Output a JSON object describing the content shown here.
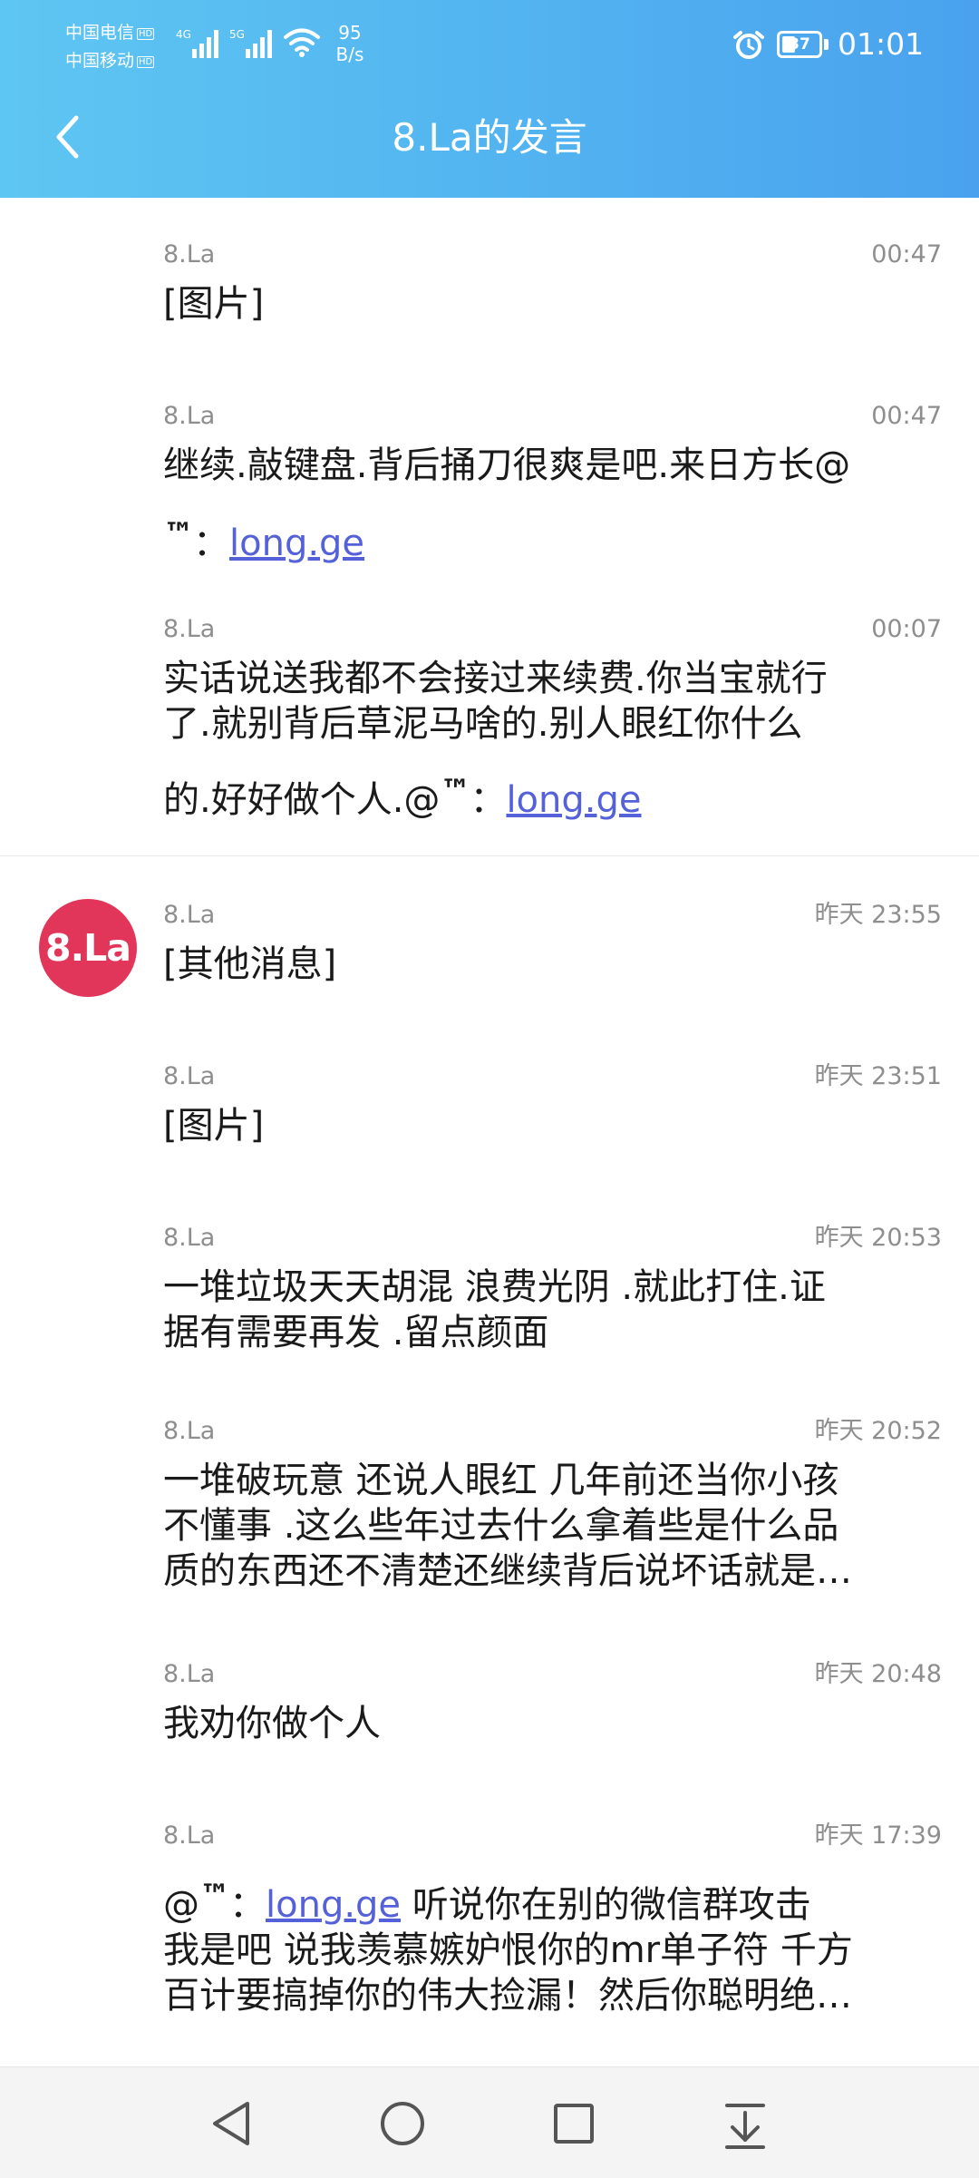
{
  "status_bar": {
    "carrier_1": "中国电信",
    "carrier_2": "中国移动",
    "hd_badge": "HD",
    "net_1": "4G",
    "net_2": "5G",
    "speed_value": "95",
    "speed_unit": "B/s",
    "battery": "37",
    "time": "01:01",
    "icons": [
      "signal-icon",
      "wifi-icon",
      "alarm-icon",
      "battery-icon"
    ]
  },
  "header": {
    "title": "8.La的发言",
    "back_icon": "chevron-left-icon"
  },
  "avatar": {
    "text": "8.La"
  },
  "messages": [
    {
      "sender": "8.La",
      "time": "00:47",
      "lines": [
        "[图片]"
      ]
    },
    {
      "sender": "8.La",
      "time": "00:47",
      "line1": "继续.敲键盘.背后捅刀很爽是吧.来日方长@",
      "at": "™",
      "colon": "：",
      "link": "long.ge"
    },
    {
      "sender": "8.La",
      "time": "00:07",
      "line1": "实话说送我都不会接过来续费.你当宝就行",
      "line2": "了.就别背后草泥马啥的.别人眼红你什么",
      "line3": "的.好好做个人.@",
      "at": "™",
      "colon": "：",
      "link": "long.ge"
    },
    {
      "sender": "8.La",
      "time": "昨天 23:55",
      "lines": [
        "[其他消息]"
      ]
    },
    {
      "sender": "8.La",
      "time": "昨天 23:51",
      "lines": [
        "[图片]"
      ]
    },
    {
      "sender": "8.La",
      "time": "昨天 20:53",
      "lines": [
        "一堆垃圾天天胡混 浪费光阴 .就此打住.证",
        "据有需要再发 .留点颜面"
      ]
    },
    {
      "sender": "8.La",
      "time": "昨天 20:52",
      "lines": [
        "一堆破玩意 还说人眼红 几年前还当你小孩",
        "不懂事 .这么些年过去什么拿着些是什么品",
        "质的东西还不清楚还继续背后说坏话就是…"
      ]
    },
    {
      "sender": "8.La",
      "time": "昨天 20:48",
      "lines": [
        "我劝你做个人"
      ]
    },
    {
      "sender": "8.La",
      "time": "昨天 17:39",
      "line1_prefix": "@",
      "at": "™",
      "colon": "：",
      "link": "long.ge",
      "line1_suffix": " 听说你在别的微信群攻击",
      "line2": "我是吧 说我羡慕嫉妒恨你的mr单子符 千方",
      "line3": "百计要搞掉你的伟大捡漏！然后你聪明绝…"
    }
  ],
  "navbar": {
    "icons": [
      "back-triangle-icon",
      "home-circle-icon",
      "recents-square-icon",
      "notification-pulldown-icon"
    ]
  },
  "colors": {
    "header_gradient_start": "#5ec6f2",
    "header_gradient_end": "#4aa2ee",
    "link": "#5561d8",
    "avatar_bg": "#e13659",
    "meta_text": "#8e8e8e"
  }
}
